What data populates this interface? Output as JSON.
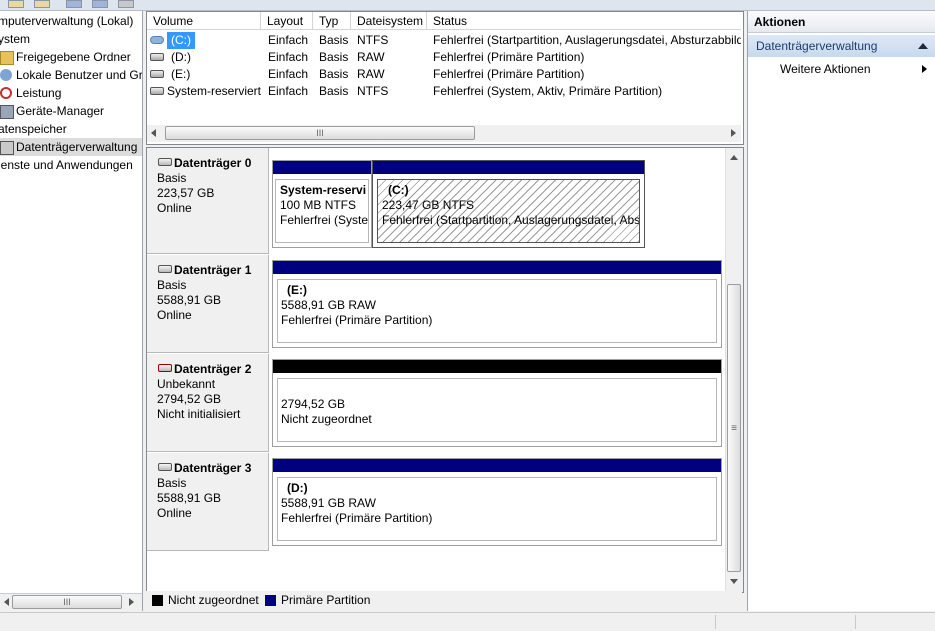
{
  "tree": {
    "items": [
      {
        "label": "mputerverwaltung (Lokal)",
        "indent": 0
      },
      {
        "label": "ystem",
        "indent": 0
      },
      {
        "label": "Freigegebene Ordner",
        "indent": 1,
        "icon": "shared-folder-icon"
      },
      {
        "label": "Lokale Benutzer und Gr",
        "indent": 1,
        "icon": "users-icon"
      },
      {
        "label": "Leistung",
        "indent": 1,
        "icon": "performance-icon"
      },
      {
        "label": "Geräte-Manager",
        "indent": 1,
        "icon": "device-manager-icon"
      },
      {
        "label": "atenspeicher",
        "indent": 0
      },
      {
        "label": "Datenträgerverwaltung",
        "indent": 1,
        "icon": "disk-management-icon",
        "selected": true
      },
      {
        "label": "ienste und Anwendungen",
        "indent": 0
      }
    ],
    "scroll_glyph": "III"
  },
  "volume_list": {
    "columns": [
      "Volume",
      "Layout",
      "Typ",
      "Dateisystem",
      "Status"
    ],
    "rows": [
      {
        "volume": "(C:)",
        "layout": "Einfach",
        "typ": "Basis",
        "fs": "NTFS",
        "status": "Fehlerfrei (Startpartition, Auslagerungsdatei, Absturzabbild",
        "selected": true
      },
      {
        "volume": "(D:)",
        "layout": "Einfach",
        "typ": "Basis",
        "fs": "RAW",
        "status": "Fehlerfrei (Primäre Partition)"
      },
      {
        "volume": "(E:)",
        "layout": "Einfach",
        "typ": "Basis",
        "fs": "RAW",
        "status": "Fehlerfrei (Primäre Partition)"
      },
      {
        "volume": "System-reserviert",
        "layout": "Einfach",
        "typ": "Basis",
        "fs": "NTFS",
        "status": "Fehlerfrei (System, Aktiv, Primäre Partition)"
      }
    ],
    "scroll_glyph": "III"
  },
  "disks": [
    {
      "title": "Datenträger 0",
      "type": "Basis",
      "size": "223,57 GB",
      "state": "Online",
      "partitions": [
        {
          "name": "System-reservi",
          "size_fs": "100 MB NTFS",
          "status": "Fehlerfrei (Syster",
          "bar_color": "#00007f"
        },
        {
          "name": "(C:)",
          "size_fs": "223,47 GB NTFS",
          "status": "Fehlerfrei (Startpartition, Auslagerungsdatei, Abstu",
          "bar_color": "#00007f",
          "selected": true
        }
      ]
    },
    {
      "title": "Datenträger 1",
      "type": "Basis",
      "size": "5588,91 GB",
      "state": "Online",
      "partitions": [
        {
          "name": "(E:)",
          "size_fs": "5588,91 GB RAW",
          "status": "Fehlerfrei (Primäre Partition)",
          "bar_color": "#00007f"
        }
      ]
    },
    {
      "title": "Datenträger 2",
      "type": "Unbekannt",
      "size": "2794,52 GB",
      "state": "Nicht initialisiert",
      "partitions": [
        {
          "name": "",
          "size_fs": "2794,52 GB",
          "status": "Nicht zugeordnet",
          "bar_color": "#000000"
        }
      ]
    },
    {
      "title": "Datenträger 3",
      "type": "Basis",
      "size": "5588,91 GB",
      "state": "Online",
      "partitions": [
        {
          "name": "(D:)",
          "size_fs": "5588,91 GB RAW",
          "status": "Fehlerfrei (Primäre Partition)",
          "bar_color": "#00007f"
        }
      ]
    }
  ],
  "graph_scroll_glyph": "≡",
  "legend": [
    {
      "label": "Nicht zugeordnet",
      "color": "#000000"
    },
    {
      "label": "Primäre Partition",
      "color": "#00007f"
    }
  ],
  "actions": {
    "header": "Aktionen",
    "section": "Datenträgerverwaltung",
    "items": [
      "Weitere Aktionen"
    ]
  }
}
